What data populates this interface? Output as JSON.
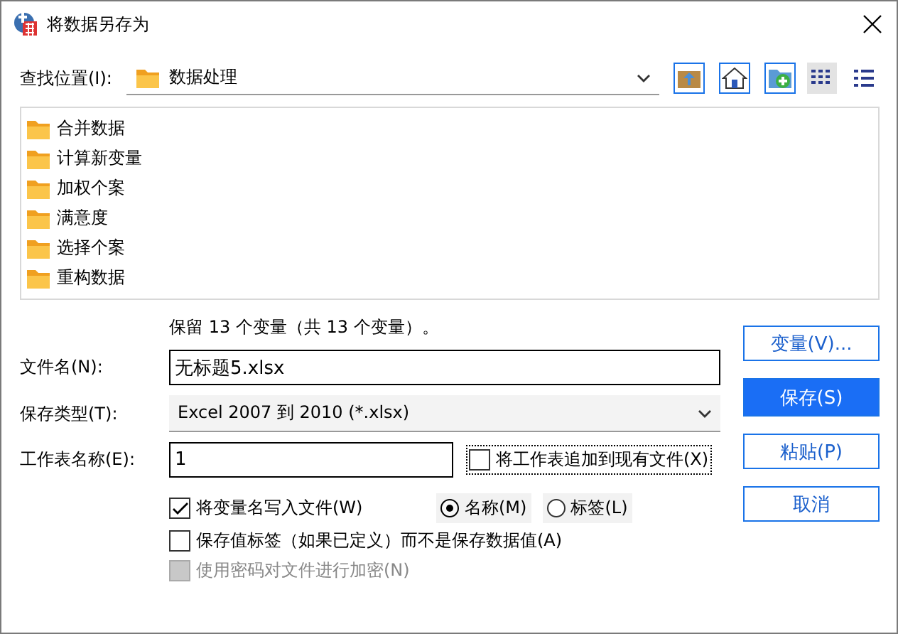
{
  "window": {
    "title": "将数据另存为"
  },
  "look_in": {
    "label": "查找位置(I):",
    "value": "数据处理"
  },
  "view_buttons": [
    {
      "kind": "list",
      "selected": true
    },
    {
      "kind": "details",
      "selected": false
    }
  ],
  "folders": [
    {
      "name": "合并数据",
      "selected": false
    },
    {
      "name": "计算新变量",
      "selected": false
    },
    {
      "name": "加权个案",
      "selected": false
    },
    {
      "name": "满意度",
      "selected": false
    },
    {
      "name": "选择个案",
      "selected": false
    },
    {
      "name": "重构数据",
      "selected": false
    }
  ],
  "summary": "保留 13 个变量（共 13 个变量）。",
  "file_name": {
    "label": "文件名(N):",
    "value": "无标题5.xlsx"
  },
  "save_type": {
    "label": "保存类型(T):",
    "value": "Excel 2007 到 2010 (*.xlsx)"
  },
  "sheet_name": {
    "label": "工作表名称(E):",
    "value": "1"
  },
  "append_sheet": {
    "label": "将工作表追加到现有文件(X)",
    "checked": false
  },
  "write_names": {
    "label": "将变量名写入文件(W)",
    "checked": true
  },
  "name_source": [
    {
      "label": "名称(M)",
      "selected": true
    },
    {
      "label": "标签(L)",
      "selected": false
    }
  ],
  "save_value_labels": {
    "label": "保存值标签（如果已定义）而不是保存数据值(A)",
    "checked": false
  },
  "encrypt": {
    "label": "使用密码对文件进行加密(N)",
    "checked": false,
    "disabled": true
  },
  "buttons": [
    {
      "label": "变量(V)...",
      "primary": false
    },
    {
      "label": "保存(S)",
      "primary": true
    },
    {
      "label": "粘贴(P)",
      "primary": false
    },
    {
      "label": "取消",
      "primary": false
    }
  ]
}
